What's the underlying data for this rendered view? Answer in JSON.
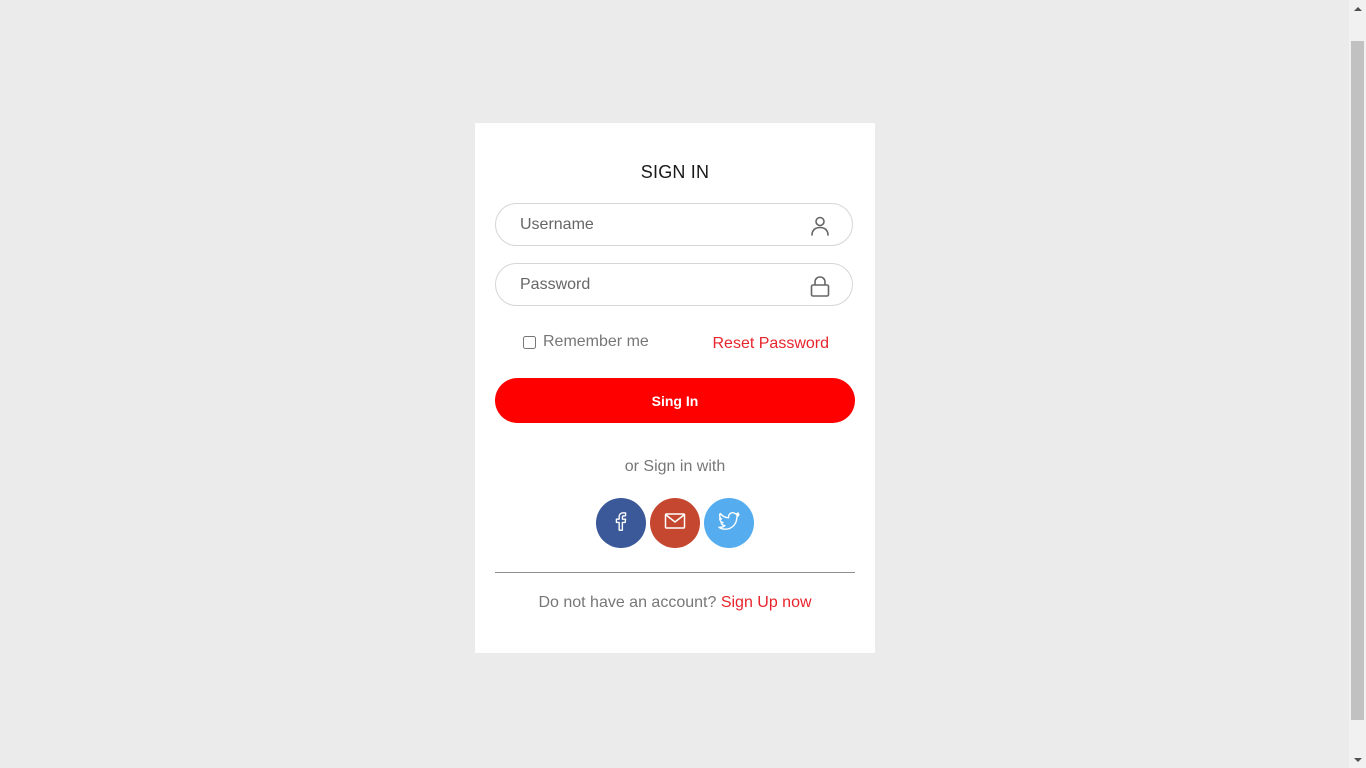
{
  "form": {
    "title": "SIGN IN",
    "username_placeholder": "Username",
    "password_placeholder": "Password",
    "remember_label": "Remember me",
    "reset_label": "Reset Password",
    "submit_label": "Sing In",
    "alt_signin_label": "or Sign in with",
    "no_account_text": "Do not have an account?",
    "signup_label": "Sign Up now"
  },
  "icons": {
    "username": "user-icon",
    "password": "lock-icon"
  },
  "socials": [
    {
      "name": "facebook",
      "icon": "facebook-icon",
      "color": "#3b5998"
    },
    {
      "name": "email",
      "icon": "mail-icon",
      "color": "#c6472f"
    },
    {
      "name": "twitter",
      "icon": "twitter-icon",
      "color": "#55acee"
    }
  ],
  "colors": {
    "accent": "#ff0000",
    "link": "#e8242b",
    "background": "#ebebeb",
    "card": "#ffffff"
  }
}
